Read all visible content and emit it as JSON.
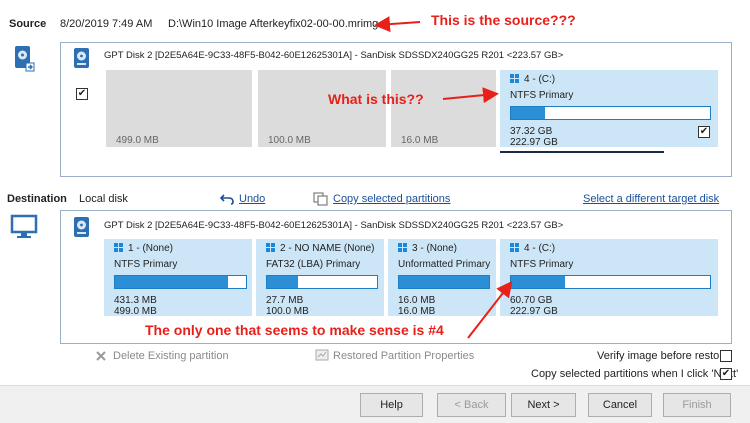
{
  "source": {
    "label": "Source",
    "date": "8/20/2019 7:49 AM",
    "path": "D:\\Win10 Image Afterkeyfix02-00-00.mrimg",
    "disk_header": "GPT Disk 2 [D2E5A64E-9C33-48F5-B042-60E12625301A] - SanDisk SDSSDX240GG25 R201  <223.57 GB>",
    "partitions": [
      {
        "size": "499.0 MB"
      },
      {
        "size": "100.0 MB"
      },
      {
        "size": "16.0 MB"
      },
      {
        "title": "4 - (C:)",
        "type": "NTFS Primary",
        "used": "37.32 GB",
        "total": "222.97 GB",
        "fill": 0.17,
        "checked": "✔"
      }
    ],
    "disk_checked": "✔"
  },
  "destination": {
    "label": "Destination",
    "local": "Local disk",
    "undo": "Undo",
    "copy_selected": "Copy selected partitions",
    "select_target": "Select a different target disk",
    "disk_header": "GPT Disk 2 [D2E5A64E-9C33-48F5-B042-60E12625301A] - SanDisk SDSSDX240GG25 R201  <223.57 GB>",
    "partitions": [
      {
        "title": "1 - (None)",
        "type": "NTFS Primary",
        "used": "431.3 MB",
        "total": "499.0 MB",
        "fill": 0.86
      },
      {
        "title": "2 - NO NAME (None)",
        "type": "FAT32 (LBA) Primary",
        "used": "27.7 MB",
        "total": "100.0 MB",
        "fill": 0.28
      },
      {
        "title": "3 - (None)",
        "type": "Unformatted Primary",
        "used": "16.0 MB",
        "total": "16.0 MB",
        "fill": 1.0
      },
      {
        "title": "4 - (C:)",
        "type": "NTFS Primary",
        "used": "60.70 GB",
        "total": "222.97 GB",
        "fill": 0.27
      }
    ]
  },
  "actions": {
    "delete": "Delete Existing partition",
    "restored_props": "Restored Partition Properties",
    "verify": "Verify image before restore",
    "copy_next": "Copy selected partitions when I click 'Next'",
    "copy_next_checked": "✔"
  },
  "buttons": {
    "help": "Help",
    "back": "< Back",
    "next": "Next >",
    "cancel": "Cancel",
    "finish": "Finish"
  },
  "annotations": {
    "a1": "This is the source???",
    "a2": "What is this??",
    "a3": "The only one that seems to make sense is #4"
  },
  "colors": {
    "annotation": "#e8201a",
    "partition_blue": "#cde6f7",
    "bar_fill": "#2a8fd6",
    "link": "#1a4f9c"
  }
}
